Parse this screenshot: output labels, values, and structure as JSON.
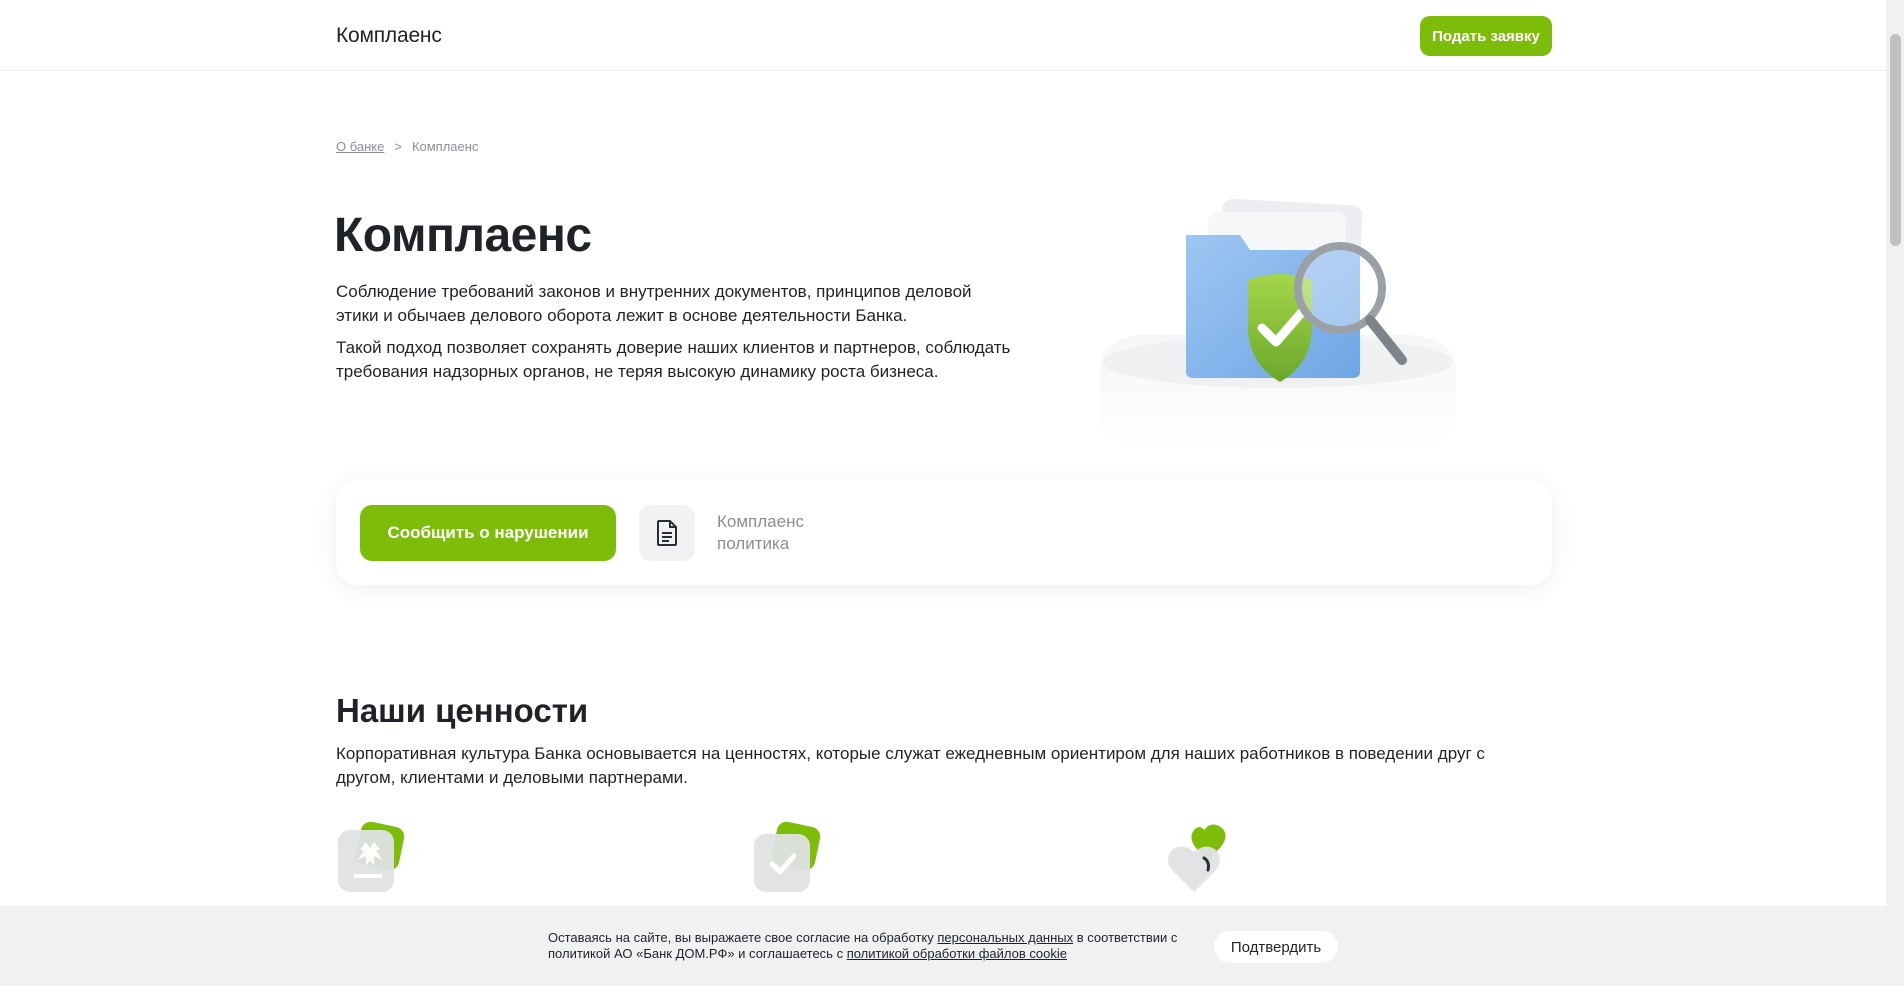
{
  "header": {
    "brand": "Комплаенс",
    "apply_button": "Подать заявку"
  },
  "breadcrumb": {
    "parent": "О банке",
    "separator": ">",
    "current": "Комплаенс"
  },
  "hero": {
    "title": "Комплаенс",
    "paragraph1": "Соблюдение требований законов и внутренних документов, принципов деловой этики и обычаев делового оборота лежит в основе деятельности Банка.",
    "paragraph2": "Такой подход позволяет сохранять доверие наших клиентов и партнеров, соблюдать требования надзорных органов, не теряя высокую динамику роста бизнеса.",
    "illustration_icon": "folder-shield-magnifier-icon"
  },
  "actions": {
    "report_button": "Сообщить о нарушении",
    "policy_link": "Комплаенс политика",
    "policy_icon": "document-icon"
  },
  "values": {
    "title": "Наши ценности",
    "text": "Корпоративная культура Банка основывается на ценностях, которые служат ежедневным ориентиром для наших работников в поведении друг с другом, клиентами и деловыми партнерами.",
    "icons": [
      "eagle-emblem-icon",
      "check-icon",
      "heart-icon"
    ]
  },
  "cookie": {
    "text_before": "Оставаясь на сайте, вы выражаете свое согласие на обработку ",
    "link1": "персональных данных",
    "text_middle": " в соответствии с политикой АО «Банк ДОМ.РФ» и соглашаетесь с ",
    "link2": "политикой обработки файлов cookie",
    "confirm_button": "Подтвердить"
  },
  "colors": {
    "accent": "#7ebc0a",
    "text": "#1f2328",
    "muted": "#8a8f96"
  }
}
